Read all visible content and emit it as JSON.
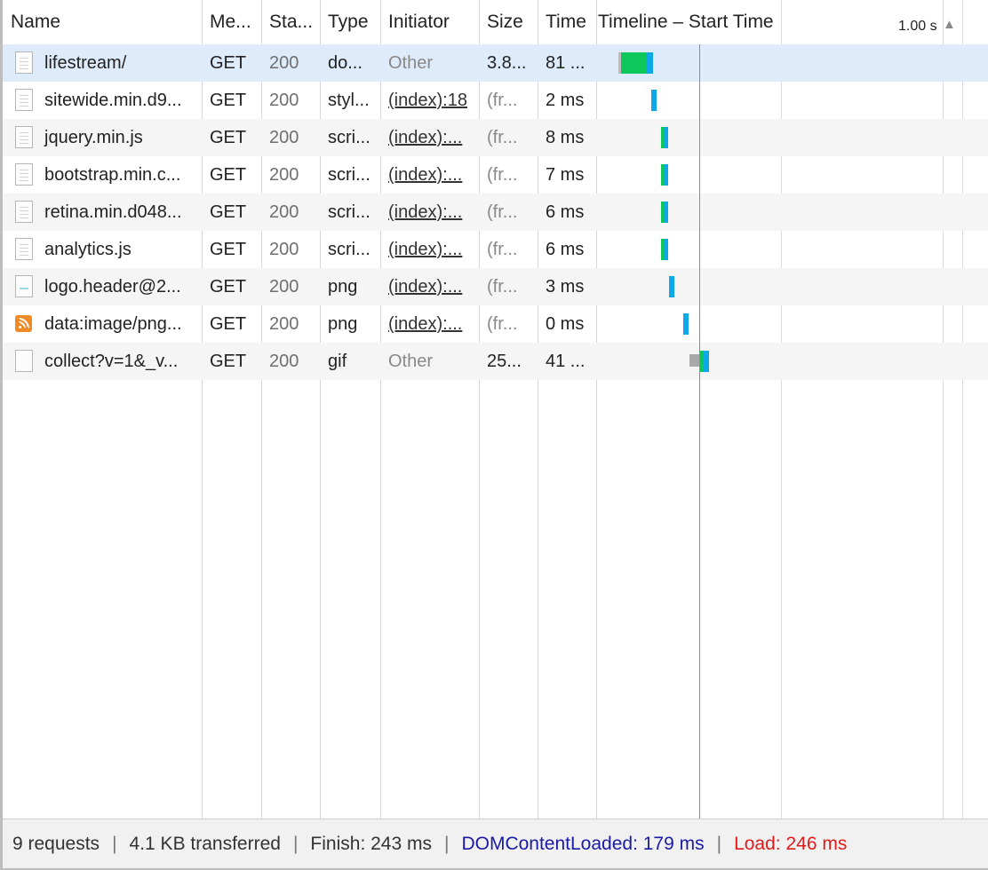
{
  "columns": {
    "name": "Name",
    "method": "Me...",
    "status": "Sta...",
    "type": "Type",
    "initiator": "Initiator",
    "size": "Size",
    "time": "Time",
    "timeline": "Timeline – Start Time"
  },
  "timeline_scale_label": "1.00 s",
  "rows": [
    {
      "name": "lifestream/",
      "method": "GET",
      "status": "200",
      "type": "do...",
      "initiator": "Other",
      "size": "3.8...",
      "time": "81 ...",
      "icon": "document-icon",
      "selected": true
    },
    {
      "name": "sitewide.min.d9...",
      "method": "GET",
      "status": "200",
      "type": "styl...",
      "initiator": "(index):18",
      "size": "(fr...",
      "time": "2 ms",
      "icon": "document-icon"
    },
    {
      "name": "jquery.min.js",
      "method": "GET",
      "status": "200",
      "type": "scri...",
      "initiator": "(index):...",
      "size": "(fr...",
      "time": "8 ms",
      "icon": "document-icon"
    },
    {
      "name": "bootstrap.min.c...",
      "method": "GET",
      "status": "200",
      "type": "scri...",
      "initiator": "(index):...",
      "size": "(fr...",
      "time": "7 ms",
      "icon": "document-icon"
    },
    {
      "name": "retina.min.d048...",
      "method": "GET",
      "status": "200",
      "type": "scri...",
      "initiator": "(index):...",
      "size": "(fr...",
      "time": "6 ms",
      "icon": "document-icon"
    },
    {
      "name": "analytics.js",
      "method": "GET",
      "status": "200",
      "type": "scri...",
      "initiator": "(index):...",
      "size": "(fr...",
      "time": "6 ms",
      "icon": "document-icon"
    },
    {
      "name": "logo.header@2...",
      "method": "GET",
      "status": "200",
      "type": "png",
      "initiator": "(index):...",
      "size": "(fr...",
      "time": "3 ms",
      "icon": "image-icon"
    },
    {
      "name": "data:image/png...",
      "method": "GET",
      "status": "200",
      "type": "png",
      "initiator": "(index):...",
      "size": "(fr...",
      "time": "0 ms",
      "icon": "rss-icon"
    },
    {
      "name": "collect?v=1&_v...",
      "method": "GET",
      "status": "200",
      "type": "gif",
      "initiator": "Other",
      "size": "25...",
      "time": "41 ...",
      "icon": "blank-file-icon"
    }
  ],
  "footer": {
    "requests": "9 requests",
    "transferred": "4.1 KB transferred",
    "finish": "Finish: 243 ms",
    "dom_content_loaded": "DOMContentLoaded: 179 ms",
    "load": "Load: 246 ms",
    "separator": "|"
  },
  "colors": {
    "selected_row": "#deebfb",
    "dom_content_loaded": "#1a1aa6",
    "load": "#e11b1b",
    "bar_document": "#0ec75a",
    "bar_resource": "#0ea7e8",
    "bar_waiting": "#a8a8a8"
  }
}
